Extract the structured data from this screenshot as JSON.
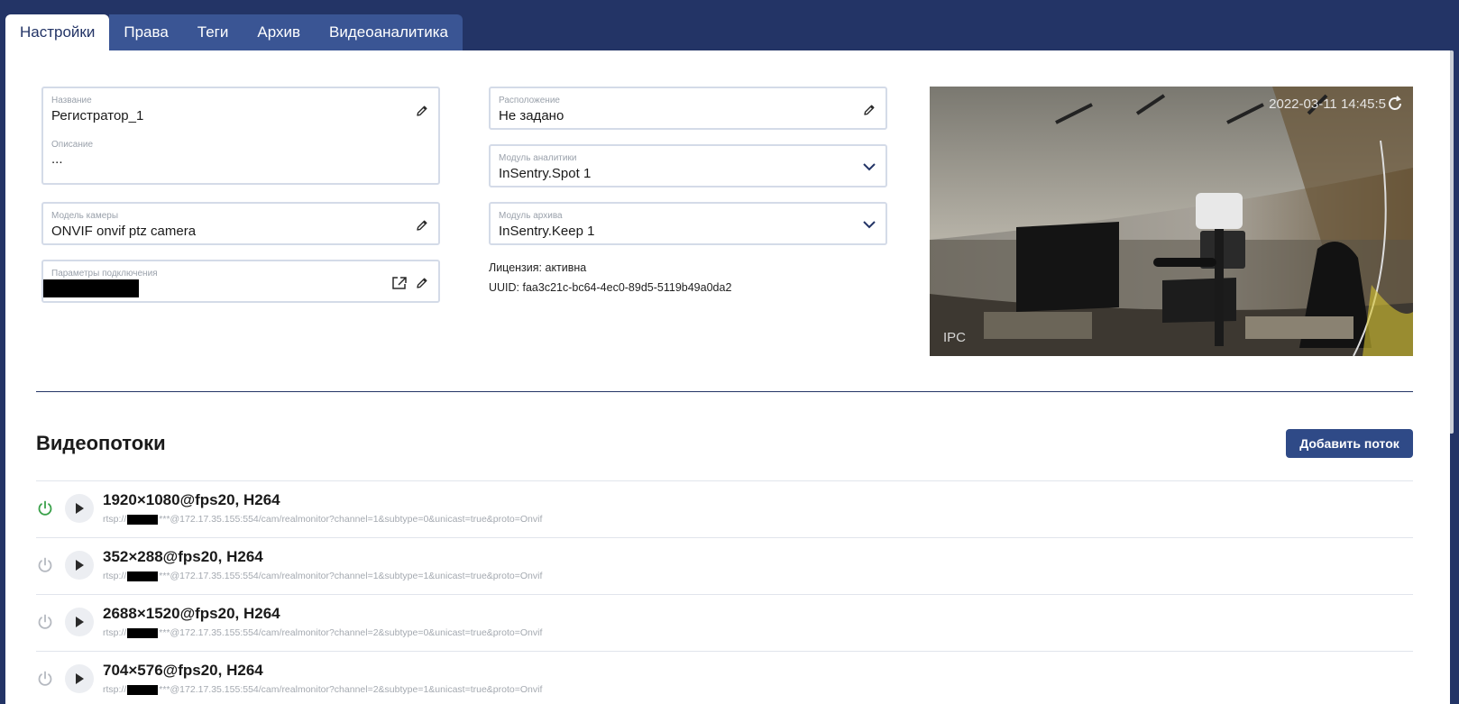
{
  "tabs": [
    {
      "label": "Настройки",
      "active": true
    },
    {
      "label": "Права"
    },
    {
      "label": "Теги"
    },
    {
      "label": "Архив"
    },
    {
      "label": "Видеоаналитика"
    }
  ],
  "fields": {
    "name": {
      "label": "Название",
      "value": "Регистратор_1"
    },
    "description": {
      "label": "Описание",
      "value": "..."
    },
    "camera_model": {
      "label": "Модель камеры",
      "value": "ONVIF onvif ptz camera"
    },
    "connection": {
      "label": "Параметры подключения"
    },
    "location": {
      "label": "Расположение",
      "value": "Не задано"
    },
    "analytics_module": {
      "label": "Модуль аналитики",
      "value": "InSentry.Spot 1"
    },
    "archive_module": {
      "label": "Модуль архива",
      "value": "InSentry.Keep 1"
    }
  },
  "info": {
    "license": "Лицензия: активна",
    "uuid": "UUID: faa3c21c-bc64-4ec0-89d5-5119b49a0da2"
  },
  "preview": {
    "timestamp": "2022-03-11 14:45:5",
    "overlay": "IPC"
  },
  "streams_section": {
    "title": "Видеопотоки",
    "add_button": "Добавить поток",
    "streams": [
      {
        "title": "1920×1080@fps20, H264",
        "url_prefix": "rtsp://",
        "url_suffix": "***@172.17.35.155:554/cam/realmonitor?channel=1&subtype=0&unicast=true&proto=Onvif",
        "enabled": true
      },
      {
        "title": "352×288@fps20, H264",
        "url_prefix": "rtsp://",
        "url_suffix": "***@172.17.35.155:554/cam/realmonitor?channel=1&subtype=1&unicast=true&proto=Onvif",
        "enabled": false
      },
      {
        "title": "2688×1520@fps20, H264",
        "url_prefix": "rtsp://",
        "url_suffix": "***@172.17.35.155:554/cam/realmonitor?channel=2&subtype=0&unicast=true&proto=Onvif",
        "enabled": false
      },
      {
        "title": "704×576@fps20, H264",
        "url_prefix": "rtsp://",
        "url_suffix": "***@172.17.35.155:554/cam/realmonitor?channel=2&subtype=1&unicast=true&proto=Onvif",
        "enabled": false
      }
    ]
  },
  "colors": {
    "header": "#233466",
    "tab": "#3a5594",
    "button": "#2f4a87",
    "power_on": "#3aa14a",
    "power_off": "#b5b9c0"
  }
}
